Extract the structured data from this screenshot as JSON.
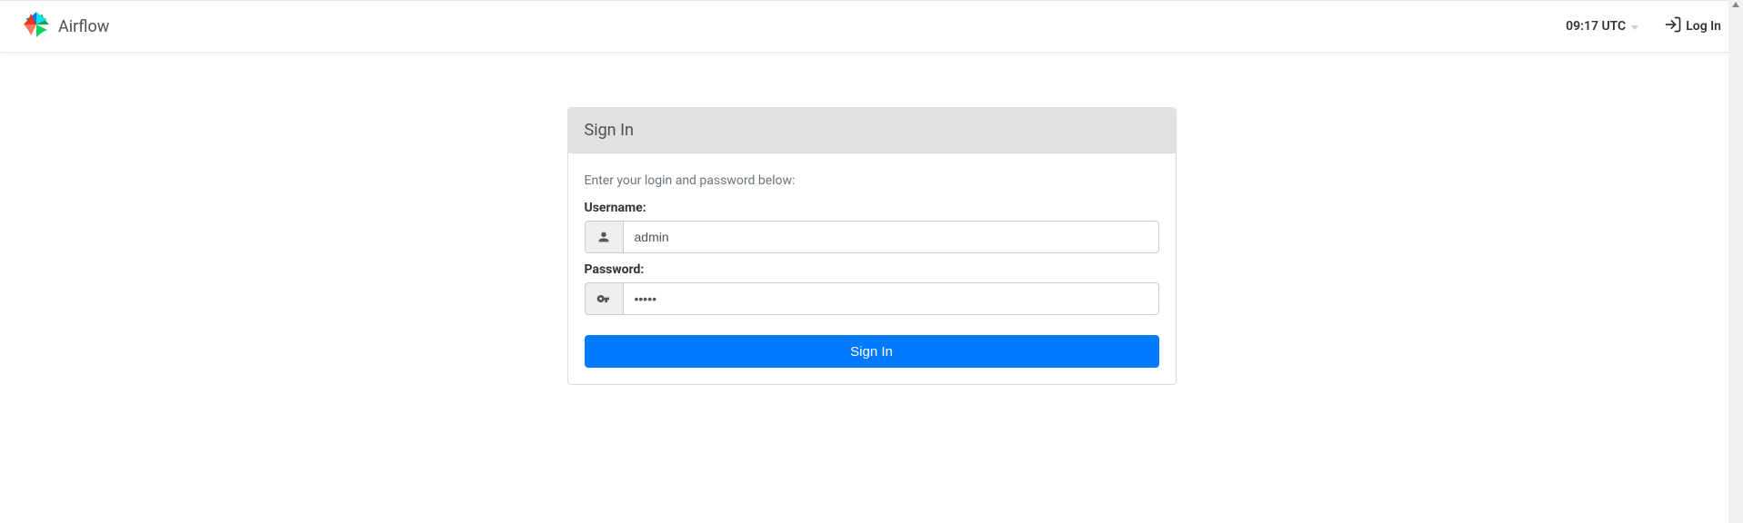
{
  "navbar": {
    "brand": "Airflow",
    "clock": "09:17 UTC",
    "login_link": "Log In"
  },
  "panel": {
    "title": "Sign In",
    "help_text": "Enter your login and password below:",
    "username_label": "Username:",
    "username_value": "admin",
    "password_label": "Password:",
    "password_value": "•••••",
    "submit_label": "Sign In"
  }
}
